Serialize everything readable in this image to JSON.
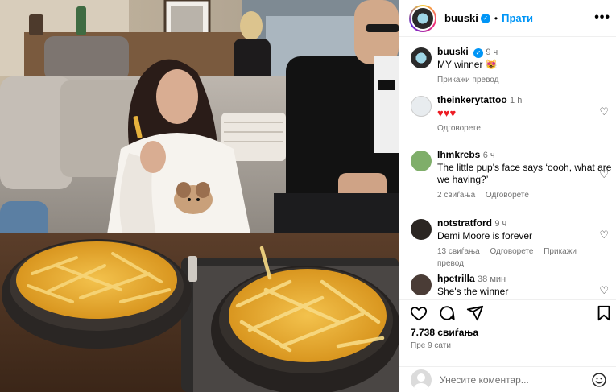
{
  "post": {
    "author": "buuski",
    "follow_label": "Прати",
    "dot": "•",
    "more_label": "•••"
  },
  "caption": {
    "author": "buuski",
    "time": "9 ч",
    "text": "MY winner 😻",
    "translate_label": "Прикажи превод"
  },
  "comments": [
    {
      "author": "theinkerytattoo",
      "time": "1 h",
      "text": "♥♥♥",
      "text_color": "#ed1c24",
      "meta": [
        "Одговорете"
      ]
    },
    {
      "author": "lhmkrebs",
      "time": "6 ч",
      "text": "The little pup's face says ‘oooh, what are we having?’",
      "meta": [
        "2 свиѓања",
        "Одговорете"
      ]
    },
    {
      "author": "notstratford",
      "time": "9 ч",
      "text": "Demi Moore is forever",
      "meta": [
        "13 свиѓања",
        "Одговорете",
        "Прикажи превод"
      ]
    },
    {
      "author": "hpetrilla",
      "time": "38 мин",
      "text": "She's the winner",
      "meta": []
    }
  ],
  "stats": {
    "likes": "7.738 свиѓања",
    "posted_ago": "Пре 9 сати"
  },
  "comment_box": {
    "placeholder": "Унесите коментар..."
  },
  "icons": [
    "verified-icon",
    "more-icon",
    "heart-icon",
    "comment-icon",
    "share-icon",
    "bookmark-icon",
    "emoji-icon"
  ],
  "colors": {
    "accent": "#0095f6",
    "muted": "#737373",
    "heart_red": "#ed1c24"
  }
}
